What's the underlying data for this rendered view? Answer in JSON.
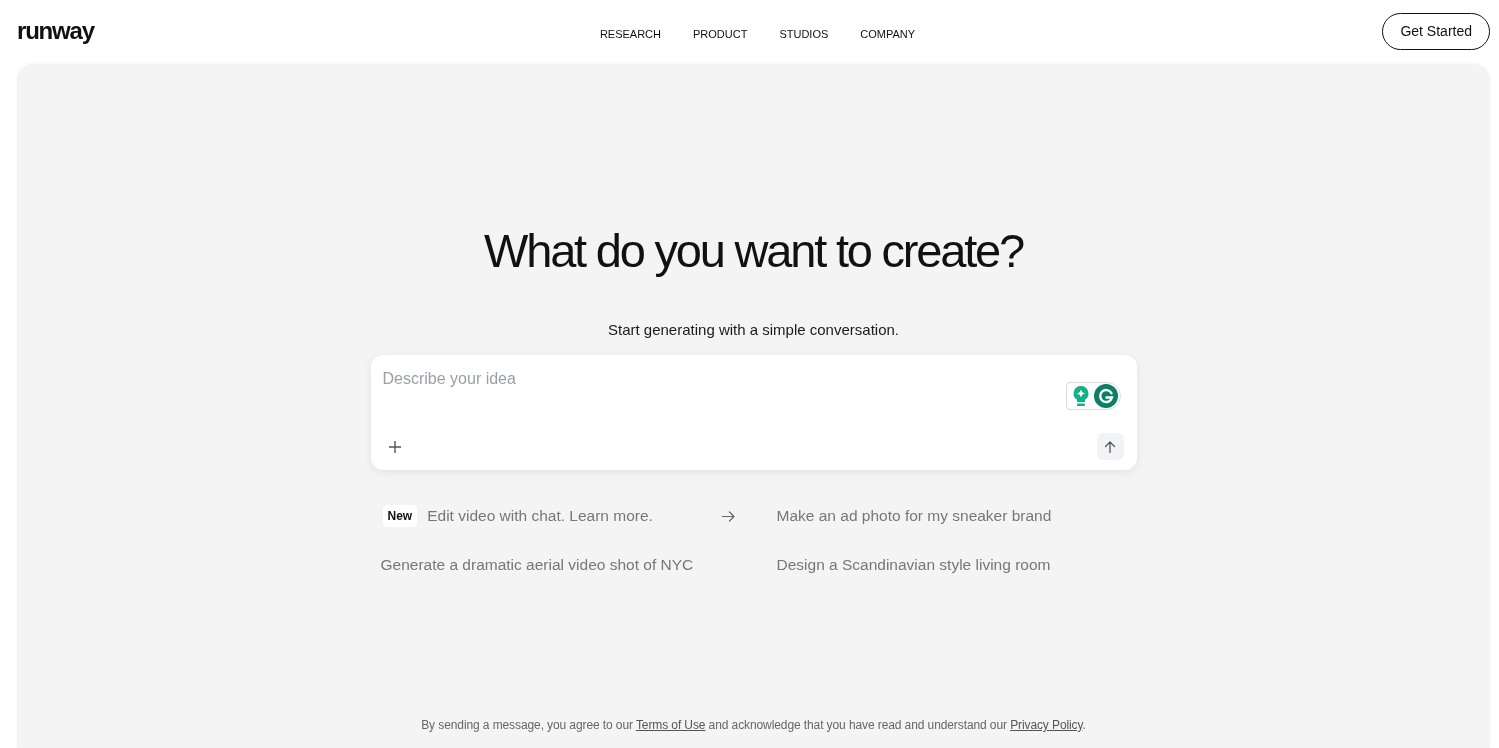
{
  "header": {
    "logo": "runway",
    "nav": [
      {
        "label": "RESEARCH"
      },
      {
        "label": "PRODUCT"
      },
      {
        "label": "STUDIOS"
      },
      {
        "label": "COMPANY"
      }
    ],
    "cta": "Get Started"
  },
  "hero": {
    "title": "What do you want to create?",
    "subtitle": "Start generating with a simple conversation."
  },
  "prompt": {
    "placeholder": "Describe your idea"
  },
  "suggestions": [
    {
      "kind": "announcement",
      "badge": "New",
      "text": "Edit video with chat. Learn more."
    },
    {
      "kind": "prompt",
      "text": "Make an ad photo for my sneaker brand"
    },
    {
      "kind": "prompt",
      "text": "Generate a dramatic aerial video shot of NYC"
    },
    {
      "kind": "prompt",
      "text": "Design a Scandinavian style living room"
    }
  ],
  "footer": {
    "segments": [
      {
        "kind": "text",
        "text": "By sending a message, you agree to our "
      },
      {
        "kind": "link",
        "text": "Terms of Use"
      },
      {
        "kind": "text",
        "text": " and acknowledge that you have read and understand our "
      },
      {
        "kind": "link",
        "text": "Privacy Policy"
      },
      {
        "kind": "text",
        "text": "."
      }
    ]
  }
}
